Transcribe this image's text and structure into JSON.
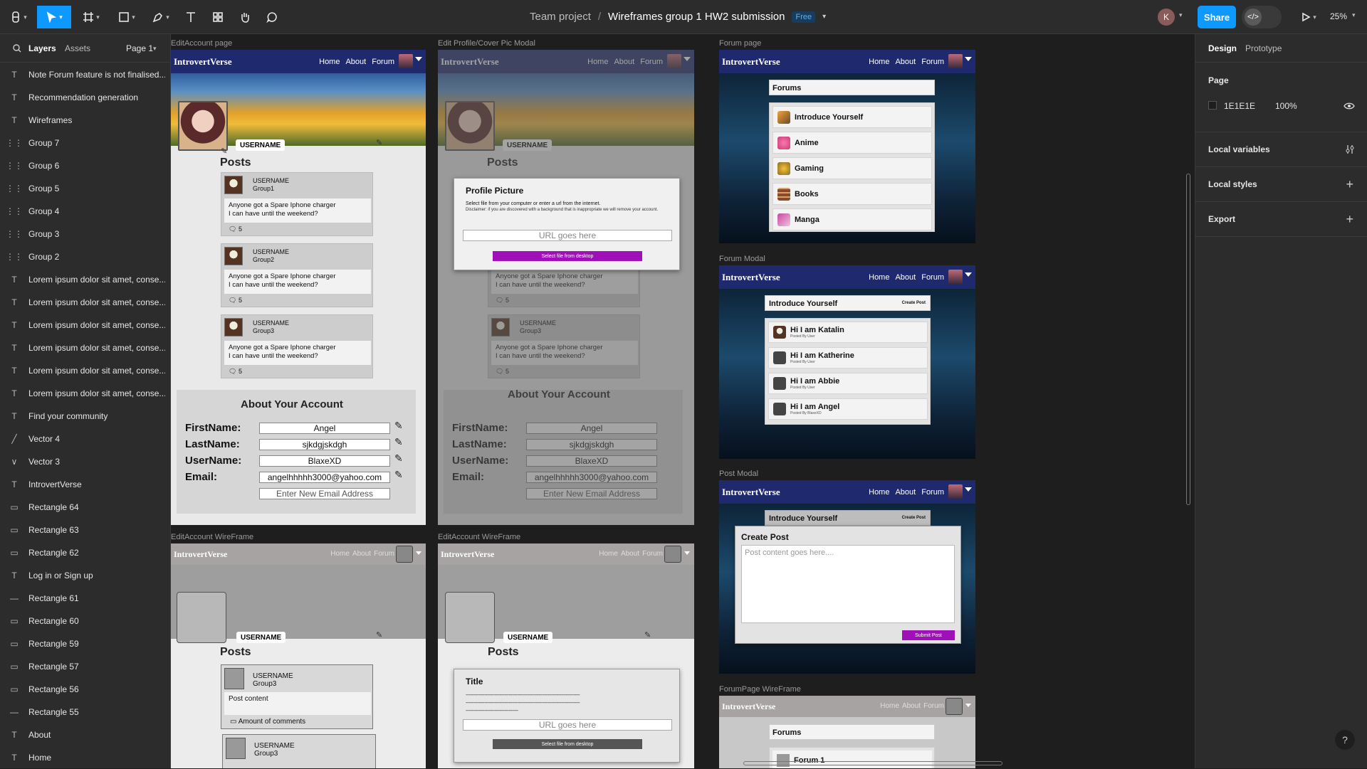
{
  "topbar": {
    "project": "Team project",
    "separator": "/",
    "file": "Wireframes group 1 HW2 submission",
    "plan_badge": "Free",
    "user_initial": "K",
    "share_label": "Share",
    "zoom": "25%"
  },
  "left": {
    "tabs": {
      "layers": "Layers",
      "assets": "Assets",
      "page": "Page 1"
    },
    "layers": [
      {
        "icon": "T",
        "label": "Note Forum feature is not finalised..."
      },
      {
        "icon": "T",
        "label": "Recommendation generation"
      },
      {
        "icon": "T",
        "label": "Wireframes"
      },
      {
        "icon": "⋮⋮",
        "label": "Group 7"
      },
      {
        "icon": "⋮⋮",
        "label": "Group 6"
      },
      {
        "icon": "⋮⋮",
        "label": "Group 5"
      },
      {
        "icon": "⋮⋮",
        "label": "Group 4"
      },
      {
        "icon": "⋮⋮",
        "label": "Group 3"
      },
      {
        "icon": "⋮⋮",
        "label": "Group 2"
      },
      {
        "icon": "T",
        "label": "Lorem ipsum dolor sit amet, conse..."
      },
      {
        "icon": "T",
        "label": "Lorem ipsum dolor sit amet, conse..."
      },
      {
        "icon": "T",
        "label": "Lorem ipsum dolor sit amet, conse..."
      },
      {
        "icon": "T",
        "label": "Lorem ipsum dolor sit amet, conse..."
      },
      {
        "icon": "T",
        "label": "Lorem ipsum dolor sit amet, conse..."
      },
      {
        "icon": "T",
        "label": "Lorem ipsum dolor sit amet, conse..."
      },
      {
        "icon": "T",
        "label": "Find your community"
      },
      {
        "icon": "╱",
        "label": "Vector 4"
      },
      {
        "icon": "∨",
        "label": "Vector 3"
      },
      {
        "icon": "T",
        "label": "IntrovertVerse"
      },
      {
        "icon": "▭",
        "label": "Rectangle 64"
      },
      {
        "icon": "▭",
        "label": "Rectangle 63"
      },
      {
        "icon": "▭",
        "label": "Rectangle 62"
      },
      {
        "icon": "T",
        "label": "Log in or Sign up"
      },
      {
        "icon": "—",
        "label": "Rectangle 61"
      },
      {
        "icon": "▭",
        "label": "Rectangle 60"
      },
      {
        "icon": "▭",
        "label": "Rectangle 59"
      },
      {
        "icon": "▭",
        "label": "Rectangle 57"
      },
      {
        "icon": "▭",
        "label": "Rectangle 56"
      },
      {
        "icon": "—",
        "label": "Rectangle 55"
      },
      {
        "icon": "T",
        "label": "About"
      },
      {
        "icon": "T",
        "label": "Home"
      }
    ]
  },
  "right": {
    "tabs": {
      "design": "Design",
      "prototype": "Prototype"
    },
    "page_section": "Page",
    "page_color": "1E1E1E",
    "page_opacity": "100%",
    "local_variables": "Local variables",
    "local_styles": "Local styles",
    "export": "Export",
    "help": "?"
  },
  "canvas": {
    "labels": {
      "edit_account": "EditAccount page",
      "edit_profile_modal": "Edit Profile/Cover Pic Modal",
      "forum_page": "Forum page",
      "forum_modal": "Forum Modal",
      "post_modal": "Post Modal",
      "edit_wf1": "EditAccount WireFrame",
      "edit_wf2": "EditAccount WireFrame",
      "forum_wf": "ForumPage WireFrame"
    },
    "brand": "IntrovertVerse",
    "nav": {
      "home": "Home",
      "about": "About",
      "forum": "Forum"
    },
    "username_tag": "USERNAME",
    "posts_heading": "Posts",
    "posts": [
      {
        "user": "USERNAME",
        "group": "Group1",
        "line1": "Anyone got a Spare Iphone charger",
        "line2": "I can have until the weekend?",
        "comments": "5"
      },
      {
        "user": "USERNAME",
        "group": "Group2",
        "line1": "Anyone got a Spare Iphone charger",
        "line2": "I can have until the weekend?",
        "comments": "5"
      },
      {
        "user": "USERNAME",
        "group": "Group3",
        "line1": "Anyone got a Spare Iphone charger",
        "line2": "I can have until the weekend?",
        "comments": "5"
      }
    ],
    "about_heading": "About Your Account",
    "fields": [
      {
        "label": "FirstName:",
        "value": "Angel"
      },
      {
        "label": "LastName:",
        "value": "sjkdgjskdgh"
      },
      {
        "label": "UserName:",
        "value": "BlaxeXD"
      },
      {
        "label": "Email:",
        "value": "angelhhhhh3000@yahoo.com"
      }
    ],
    "new_email_placeholder": "Enter New Email Address",
    "profile_modal": {
      "title": "Profile Picture",
      "line1": "Select file from your computer or enter a url from the internet.",
      "line2": "Disclaimer: if you are discovered with a background that is inappropriate we will remove your account.",
      "url": "URL goes here",
      "button": "Select file from desktop"
    },
    "forums": {
      "title": "Forums",
      "items": [
        "Introduce Yourself",
        "Anime",
        "Gaming",
        "Books",
        "Manga"
      ]
    },
    "forum_modal": {
      "title": "Introduce Yourself",
      "create": "Create Post",
      "posts": [
        {
          "title": "Hi I am Katalin",
          "by": "Posted By User"
        },
        {
          "title": "Hi I am Katherine",
          "by": "Posted By User"
        },
        {
          "title": "Hi I am Abbie",
          "by": "Posted By User"
        },
        {
          "title": "Hi I am Angel",
          "by": "Posted By BlaxeXD"
        }
      ]
    },
    "post_modal": {
      "title": "Create Post",
      "placeholder": "Post content goes here....",
      "submit": "Submit Post"
    },
    "wireframe": {
      "user": "USERNAME",
      "group": "Group3",
      "content": "Post content",
      "comments": "Amount of comments",
      "title": "Title",
      "dashes": "--------------------------------------------------------------------------",
      "dashes_short": "----------------------------------",
      "url": "URL goes here",
      "button": "Select file from desktop",
      "forums": "Forums",
      "forum1": "Forum 1"
    }
  }
}
